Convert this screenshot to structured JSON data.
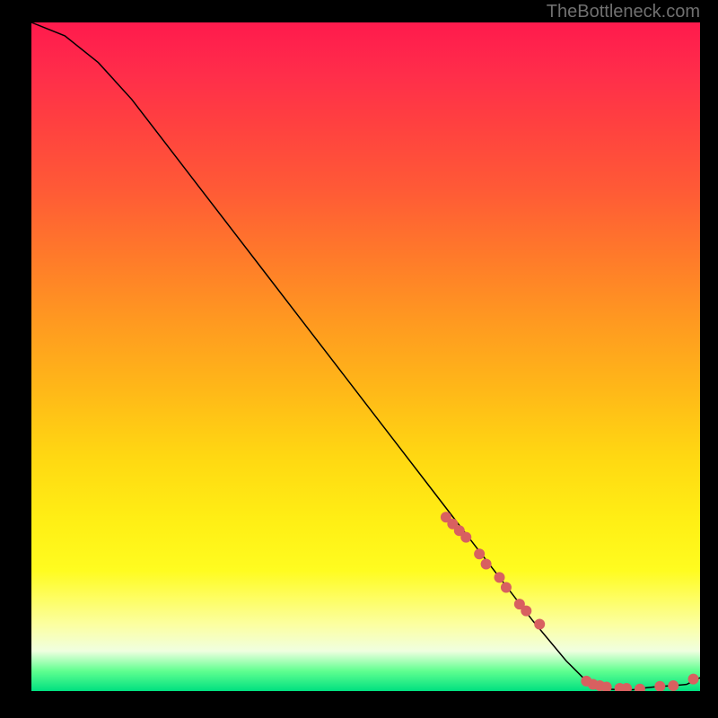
{
  "watermark": "TheBottleneck.com",
  "chart_data": {
    "type": "line",
    "title": "",
    "xlabel": "",
    "ylabel": "",
    "xlim": [
      0,
      100
    ],
    "ylim": [
      0,
      100
    ],
    "curve": {
      "name": "bottleneck-curve",
      "x": [
        0,
        5,
        10,
        15,
        20,
        25,
        30,
        35,
        40,
        45,
        50,
        55,
        60,
        65,
        70,
        75,
        80,
        83,
        86,
        88,
        90,
        92,
        94,
        96,
        98,
        100
      ],
      "y": [
        100,
        98,
        94,
        88.5,
        82,
        75.5,
        69,
        62.5,
        56,
        49.5,
        43,
        36.5,
        30,
        23.5,
        17,
        10.5,
        4.5,
        1.5,
        0.3,
        0.2,
        0.2,
        0.5,
        0.7,
        0.8,
        1.0,
        2.0
      ]
    },
    "markers": {
      "name": "highlighted-points",
      "color": "#d86060",
      "x": [
        62,
        63,
        64,
        65,
        67,
        68,
        70,
        71,
        73,
        74,
        76,
        83,
        84,
        85,
        86,
        88,
        89,
        91,
        94,
        96,
        99
      ],
      "y": [
        26,
        25,
        24,
        23,
        20.5,
        19,
        17,
        15.5,
        13,
        12,
        10,
        1.5,
        1.0,
        0.8,
        0.6,
        0.4,
        0.4,
        0.3,
        0.7,
        0.8,
        1.8
      ]
    }
  }
}
